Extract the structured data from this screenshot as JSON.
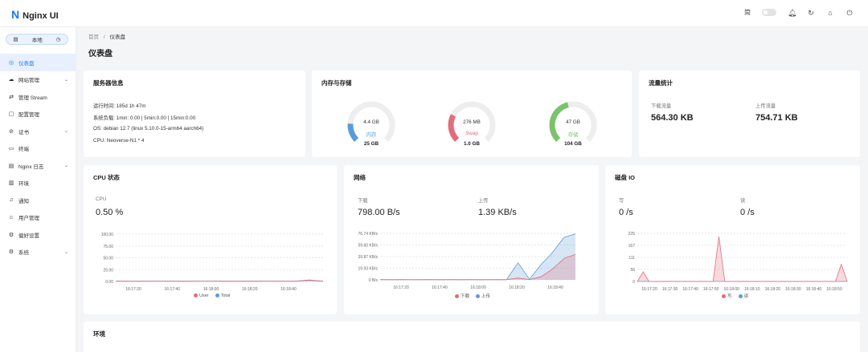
{
  "app": {
    "name": "Nginx UI",
    "logo_letter": "N"
  },
  "topbar": {
    "lang": "简",
    "icons": [
      "bell-icon",
      "reload-icon",
      "home-icon",
      "logout-icon"
    ]
  },
  "env_switch": {
    "label": "本地"
  },
  "sidebar": {
    "items": [
      {
        "label": "仪表盘",
        "icon": "◎",
        "active": true,
        "chev": ""
      },
      {
        "label": "网站管理",
        "icon": "☁",
        "active": false,
        "chev": "⌄"
      },
      {
        "label": "管理 Stream",
        "icon": "⇄",
        "active": false,
        "chev": ""
      },
      {
        "label": "配置管理",
        "icon": "▢",
        "active": false,
        "chev": ""
      },
      {
        "label": "证书",
        "icon": "⊘",
        "active": false,
        "chev": "⌄"
      },
      {
        "label": "终端",
        "icon": "▭",
        "active": false,
        "chev": ""
      },
      {
        "label": "Nginx 日志",
        "icon": "▤",
        "active": false,
        "chev": "⌄"
      },
      {
        "label": "环境",
        "icon": "▥",
        "active": false,
        "chev": ""
      },
      {
        "label": "通知",
        "icon": "♫",
        "active": false,
        "chev": ""
      },
      {
        "label": "用户管理",
        "icon": "☺",
        "active": false,
        "chev": ""
      },
      {
        "label": "偏好设置",
        "icon": "⚙",
        "active": false,
        "chev": ""
      },
      {
        "label": "系统",
        "icon": "⚙",
        "active": false,
        "chev": "⌄"
      }
    ]
  },
  "breadcrumb": {
    "home": "首页",
    "sep": "/",
    "current": "仪表盘"
  },
  "page_title": "仪表盘",
  "server_info": {
    "title": "服务器信息",
    "uptime": "运行时间: 185d 1h 47m",
    "load": "系统负载: 1min: 0.00 | 5min:0.00 | 15min:0.00",
    "os": "OS: debian 12.7 (linux 5.10.0-15-arm64 aarch64)",
    "cpu": "CPU: Neoverse-N1 * 4"
  },
  "memory": {
    "title": "内存与存储",
    "gauges": [
      {
        "value": "4.4 GB",
        "name": "内存",
        "total": "25 GB",
        "color": "#5b9bd9",
        "fraction": 0.18
      },
      {
        "value": "276 MB",
        "name": "Swap",
        "total": "1.0 GB",
        "color": "#e36c7c",
        "fraction": 0.27
      },
      {
        "value": "47 GB",
        "name": "存储",
        "total": "104 GB",
        "color": "#7ac36a",
        "fraction": 0.45
      }
    ]
  },
  "traffic": {
    "title": "流量统计",
    "down_label": "下载流量",
    "down_value": "564.30 KB",
    "up_label": "上传流量",
    "up_value": "754.71 KB"
  },
  "cpu_card": {
    "title": "CPU 状态",
    "label": "CPU",
    "value": "0.50 %",
    "legend": [
      {
        "name": "User",
        "color": "#e36c7c"
      },
      {
        "name": "Total",
        "color": "#5b9bd9"
      }
    ]
  },
  "network_card": {
    "title": "网络",
    "down_label": "下载",
    "down_value": "798.00 B/s",
    "up_label": "上传",
    "up_value": "1.39 KB/s",
    "legend": [
      {
        "name": "下载",
        "color": "#e36c7c"
      },
      {
        "name": "上传",
        "color": "#5b9bd9"
      }
    ]
  },
  "disk_card": {
    "title": "磁盘 IO",
    "write_label": "写",
    "write_value": "0 /s",
    "read_label": "读",
    "read_value": "0 /s",
    "legend": [
      {
        "name": "写",
        "color": "#e36c7c"
      },
      {
        "name": "读",
        "color": "#5b9bd9"
      }
    ]
  },
  "env_card": {
    "title": "环境"
  },
  "chart_data": [
    {
      "type": "area",
      "id": "cpu",
      "x": [
        "16:17:20",
        "16:17:40",
        "16:18:00",
        "16:18:20",
        "16:18:40"
      ],
      "yticks": [
        "100.00",
        "75.00",
        "50.00",
        "25.00",
        "0.00"
      ],
      "ylim": [
        0,
        100
      ],
      "series": [
        {
          "name": "User",
          "values": [
            0.3,
            0.4,
            0.3,
            0.5,
            0.4,
            0.3,
            0.4,
            0.5,
            0.3,
            0.4,
            0.3,
            0.5,
            0.4,
            0.3,
            2.5,
            0.4
          ]
        },
        {
          "name": "Total",
          "values": [
            0.5,
            0.6,
            0.5,
            0.7,
            0.6,
            0.5,
            0.6,
            0.7,
            0.5,
            0.6,
            0.5,
            0.7,
            0.6,
            0.5,
            3.0,
            0.5
          ]
        }
      ]
    },
    {
      "type": "area",
      "id": "network",
      "x": [
        "16:17:20",
        "16:17:40",
        "16:18:00",
        "16:18:20",
        "16:18:40"
      ],
      "yticks": [
        "76.74 KB/s",
        "59.60 KB/s",
        "39.87 KB/s",
        "19.93 KB/s",
        "0 B/s"
      ],
      "ylim": [
        0,
        76.74
      ],
      "series": [
        {
          "name": "下载",
          "values": [
            0.3,
            0.2,
            0.3,
            0.2,
            0.3,
            0.2,
            0.3,
            0.2,
            0.3,
            0.2,
            0.3,
            0.2,
            3.0,
            0.5,
            5.0,
            18.0,
            35.0,
            42.0
          ]
        },
        {
          "name": "上传",
          "values": [
            0.4,
            0.3,
            0.4,
            0.3,
            0.4,
            0.3,
            0.4,
            0.3,
            0.4,
            0.3,
            0.4,
            0.3,
            28.0,
            1.0,
            25.0,
            45.0,
            70.0,
            76.0
          ]
        }
      ]
    },
    {
      "type": "area",
      "id": "disk",
      "x": [
        "16:17:20",
        "16:17:30",
        "16:17:40",
        "16:17:50",
        "16:18:00",
        "16:18:10",
        "16:18:20",
        "16:18:30",
        "16:18:40",
        "16:18:50"
      ],
      "yticks": [
        "225",
        "167",
        "111",
        "56",
        "0"
      ],
      "ylim": [
        0,
        225
      ],
      "series": [
        {
          "name": "写",
          "values": [
            0,
            45,
            0,
            0,
            0,
            0,
            0,
            0,
            0,
            0,
            0,
            0,
            0,
            0,
            210,
            0,
            0,
            0,
            0,
            0,
            0,
            0,
            0,
            0,
            0,
            0,
            0,
            0,
            0,
            0,
            0,
            0,
            0,
            0,
            0,
            80,
            0
          ]
        },
        {
          "name": "读",
          "values": [
            0,
            0,
            0,
            0,
            0,
            0,
            0,
            0,
            0,
            0,
            0,
            0,
            0,
            0,
            0,
            0,
            0,
            0,
            0,
            0,
            0,
            0,
            0,
            0,
            0,
            0,
            0,
            0,
            0,
            0,
            0,
            0,
            0,
            0,
            0,
            0,
            0
          ]
        }
      ]
    }
  ]
}
